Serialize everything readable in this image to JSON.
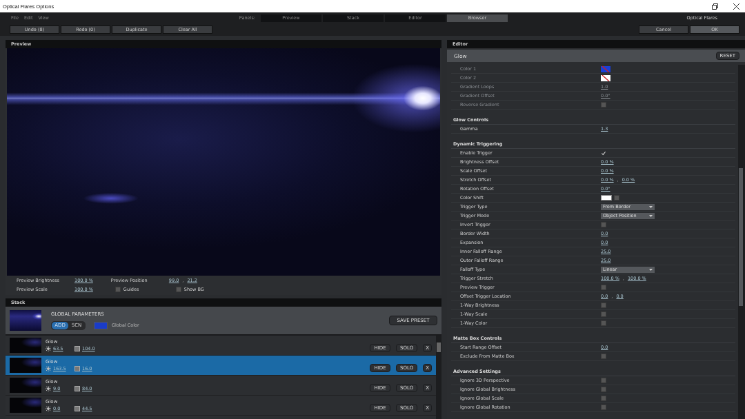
{
  "window": {
    "title": "Optical Flares Options"
  },
  "menu": [
    "File",
    "Edit",
    "View"
  ],
  "panels": {
    "label": "Panels:",
    "tabs": [
      {
        "label": "Preview",
        "selected": false
      },
      {
        "label": "Stack",
        "selected": false
      },
      {
        "label": "Editor",
        "selected": false
      },
      {
        "label": "Browser",
        "selected": true
      }
    ]
  },
  "brand": "Optical Flares",
  "toolbar": {
    "left": [
      "Undo (8)",
      "Redo (0)",
      "Duplicate",
      "Clear All"
    ],
    "right": [
      "Cancel",
      "OK"
    ]
  },
  "preview": {
    "title": "Preview",
    "brightness": {
      "label": "Preview Brightness",
      "value": "100.0 %"
    },
    "scale": {
      "label": "Preview Scale",
      "value": "100.0 %"
    },
    "position": {
      "label": "Preview Position",
      "values": [
        "99.0",
        "21.2"
      ],
      "separator": ","
    },
    "guides": {
      "label": "Guides",
      "checked": false
    },
    "show_bg": {
      "label": "Show BG",
      "checked": false
    }
  },
  "stack": {
    "title": "Stack",
    "global": {
      "title": "GLOBAL PARAMETERS",
      "modes": [
        {
          "label": "ADD",
          "selected": true
        },
        {
          "label": "SCN",
          "selected": false
        }
      ],
      "color_label": "Global Color",
      "color": "#1a3cc8",
      "button": "SAVE PRESET"
    },
    "layers": [
      {
        "name": "Glow",
        "brightness": "63.5",
        "scale": "104.0",
        "selected": false,
        "buttons": [
          "HIDE",
          "SOLO",
          "X"
        ]
      },
      {
        "name": "Glow",
        "brightness": "163.5",
        "scale": "16.0",
        "selected": true,
        "buttons": [
          "HIDE",
          "SOLO",
          "X"
        ]
      },
      {
        "name": "Glow",
        "brightness": "9.0",
        "scale": "84.0",
        "selected": false,
        "buttons": [
          "HIDE",
          "SOLO",
          "X"
        ]
      },
      {
        "name": "Glow",
        "brightness": "0.0",
        "scale": "44.5",
        "selected": false,
        "buttons": [
          "HIDE",
          "SOLO",
          "X"
        ]
      }
    ]
  },
  "editor": {
    "title": "Editor",
    "layer": "Glow",
    "reset": "RESET",
    "sections": [
      {
        "disabled": true,
        "rows": [
          {
            "label": "Color 1",
            "kind": "color",
            "color": "#1a40d8"
          },
          {
            "label": "Color 2",
            "kind": "color",
            "color": "#ffffff"
          },
          {
            "label": "Gradient Loops",
            "kind": "value",
            "values": [
              "1.0"
            ]
          },
          {
            "label": "Gradient Offset",
            "kind": "value",
            "values": [
              "0.0°"
            ]
          },
          {
            "label": "Reverse Gradient",
            "kind": "check",
            "checked": false
          }
        ]
      },
      {
        "title": "Glow Controls",
        "disabled": false,
        "rows": [
          {
            "label": "Gamma",
            "kind": "value",
            "values": [
              "1.3"
            ]
          }
        ]
      },
      {
        "title": "Dynamic Triggering",
        "disabled": false,
        "rows": [
          {
            "label": "Enable Trigger",
            "kind": "check",
            "checked": true
          },
          {
            "label": "Brightness Offset",
            "kind": "value",
            "values": [
              "0.0 %"
            ]
          },
          {
            "label": "Scale Offset",
            "kind": "value",
            "values": [
              "0.0 %"
            ]
          },
          {
            "label": "Stretch Offset",
            "kind": "value",
            "values": [
              "0.0 %",
              "0.0 %"
            ],
            "separator": ","
          },
          {
            "label": "Rotation Offset",
            "kind": "value",
            "values": [
              "0.0°"
            ]
          },
          {
            "label": "Color Shift",
            "kind": "color_check",
            "color": "#ffffff",
            "checked": false
          },
          {
            "label": "Trigger Type",
            "kind": "dropdown",
            "value": "From Border"
          },
          {
            "label": "Trigger Mode",
            "kind": "dropdown",
            "value": "Object Position"
          },
          {
            "label": "Invert Trigger",
            "kind": "check",
            "checked": false
          },
          {
            "label": "Border Width",
            "kind": "value",
            "values": [
              "0.0"
            ]
          },
          {
            "label": "Expansion",
            "kind": "value",
            "values": [
              "0.0"
            ]
          },
          {
            "label": "Inner Falloff Range",
            "kind": "value",
            "values": [
              "25.0"
            ]
          },
          {
            "label": "Outer Falloff Range",
            "kind": "value",
            "values": [
              "25.0"
            ]
          },
          {
            "label": "Falloff Type",
            "kind": "dropdown",
            "value": "Linear"
          },
          {
            "label": "Trigger Stretch",
            "kind": "value",
            "values": [
              "100.0 %",
              "100.0 %"
            ],
            "separator": ","
          },
          {
            "label": "Preview Trigger",
            "kind": "check",
            "checked": false
          },
          {
            "label": "Offset Trigger Location",
            "kind": "value",
            "values": [
              "0.0",
              "0.0"
            ],
            "separator": ","
          },
          {
            "label": "1-Way Brightness",
            "kind": "check",
            "checked": false
          },
          {
            "label": "1-Way Scale",
            "kind": "check",
            "checked": false
          },
          {
            "label": "1-Way Color",
            "kind": "check",
            "checked": false
          }
        ]
      },
      {
        "title": "Matte Box Controls",
        "disabled": false,
        "rows": [
          {
            "label": "Start Range Offset",
            "kind": "value",
            "values": [
              "0.0"
            ]
          },
          {
            "label": "Exclude From Matte Box",
            "kind": "check",
            "checked": false
          }
        ]
      },
      {
        "title": "Advanced Settings",
        "disabled": false,
        "rows": [
          {
            "label": "Ignore 3D Perspective",
            "kind": "check",
            "checked": false
          },
          {
            "label": "Ignore Global Brightness",
            "kind": "check",
            "checked": false
          },
          {
            "label": "Ignore Global Scale",
            "kind": "check",
            "checked": false
          },
          {
            "label": "Ignore Global Rotation",
            "kind": "check",
            "checked": false
          }
        ]
      }
    ]
  }
}
